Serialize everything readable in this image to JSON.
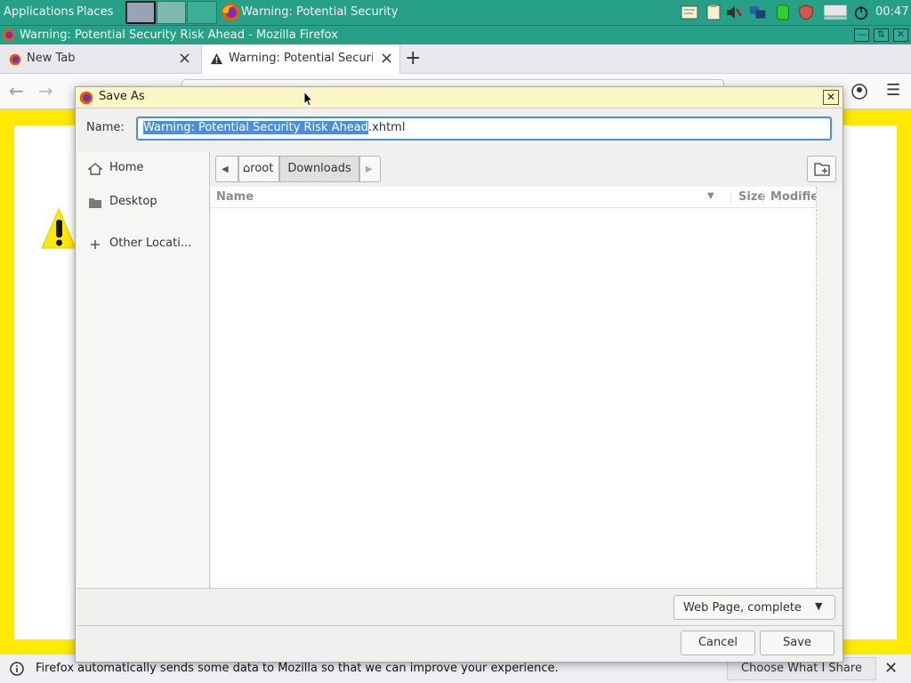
{
  "top_panel": {
    "applications": "Applications",
    "places": "Places",
    "task_label": "Warning: Potential Security",
    "clock": "00:47",
    "tray_icons": [
      "notes-icon",
      "clipboard-icon",
      "volume-muted-icon",
      "network-icon",
      "battery-icon",
      "shield-icon",
      "display-icon",
      "power-icon"
    ]
  },
  "firefox": {
    "window_title": "Warning: Potential Security Risk Ahead - Mozilla Firefox",
    "tabs": [
      {
        "label": "New Tab"
      },
      {
        "label": "Warning: Potential Securi"
      }
    ],
    "notification": {
      "text": "Firefox automatically sends some data to Mozilla so that we can improve your experience.",
      "button": "Choose What I Share"
    }
  },
  "dialog": {
    "title": "Save As",
    "name_label": "Name:",
    "filename_selected": "Warning: Potential Security Risk Ahead",
    "filename_ext": ".xhtml",
    "places": [
      {
        "label": "Home",
        "icon": "home-icon"
      },
      {
        "label": "Desktop",
        "icon": "folder-icon"
      },
      {
        "label": "Other Locati...",
        "icon": "plus-icon"
      }
    ],
    "path": {
      "root": "root",
      "current": "Downloads"
    },
    "columns": {
      "name": "Name",
      "size": "Size",
      "modified": "Modifie"
    },
    "filter": "Web Page, complete",
    "cancel": "Cancel",
    "save": "Save"
  },
  "colors": {
    "panel": "#26a188",
    "page_border": "#ffe900",
    "selection": "#4a90d9",
    "dialog_title": "#fbf6c5"
  }
}
